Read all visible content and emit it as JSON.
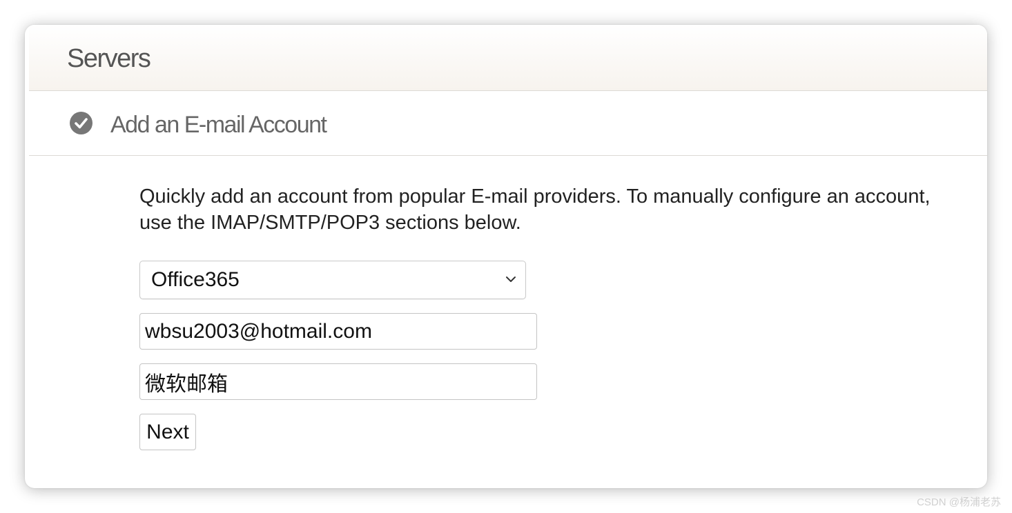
{
  "panel": {
    "title": "Servers"
  },
  "section": {
    "icon": "check-circle-icon",
    "title": "Add an E-mail Account"
  },
  "form": {
    "description": "Quickly add an account from popular E-mail providers. To manually configure an account, use the IMAP/SMTP/POP3 sections below.",
    "provider": {
      "selected": "Office365"
    },
    "email": {
      "value": "wbsu2003@hotmail.com"
    },
    "name": {
      "value": "微软邮箱"
    },
    "next_label": "Next"
  },
  "watermark": "CSDN @杨浦老苏",
  "colors": {
    "title_text": "#555555",
    "icon": "#777777",
    "border": "#c4c4c4"
  }
}
